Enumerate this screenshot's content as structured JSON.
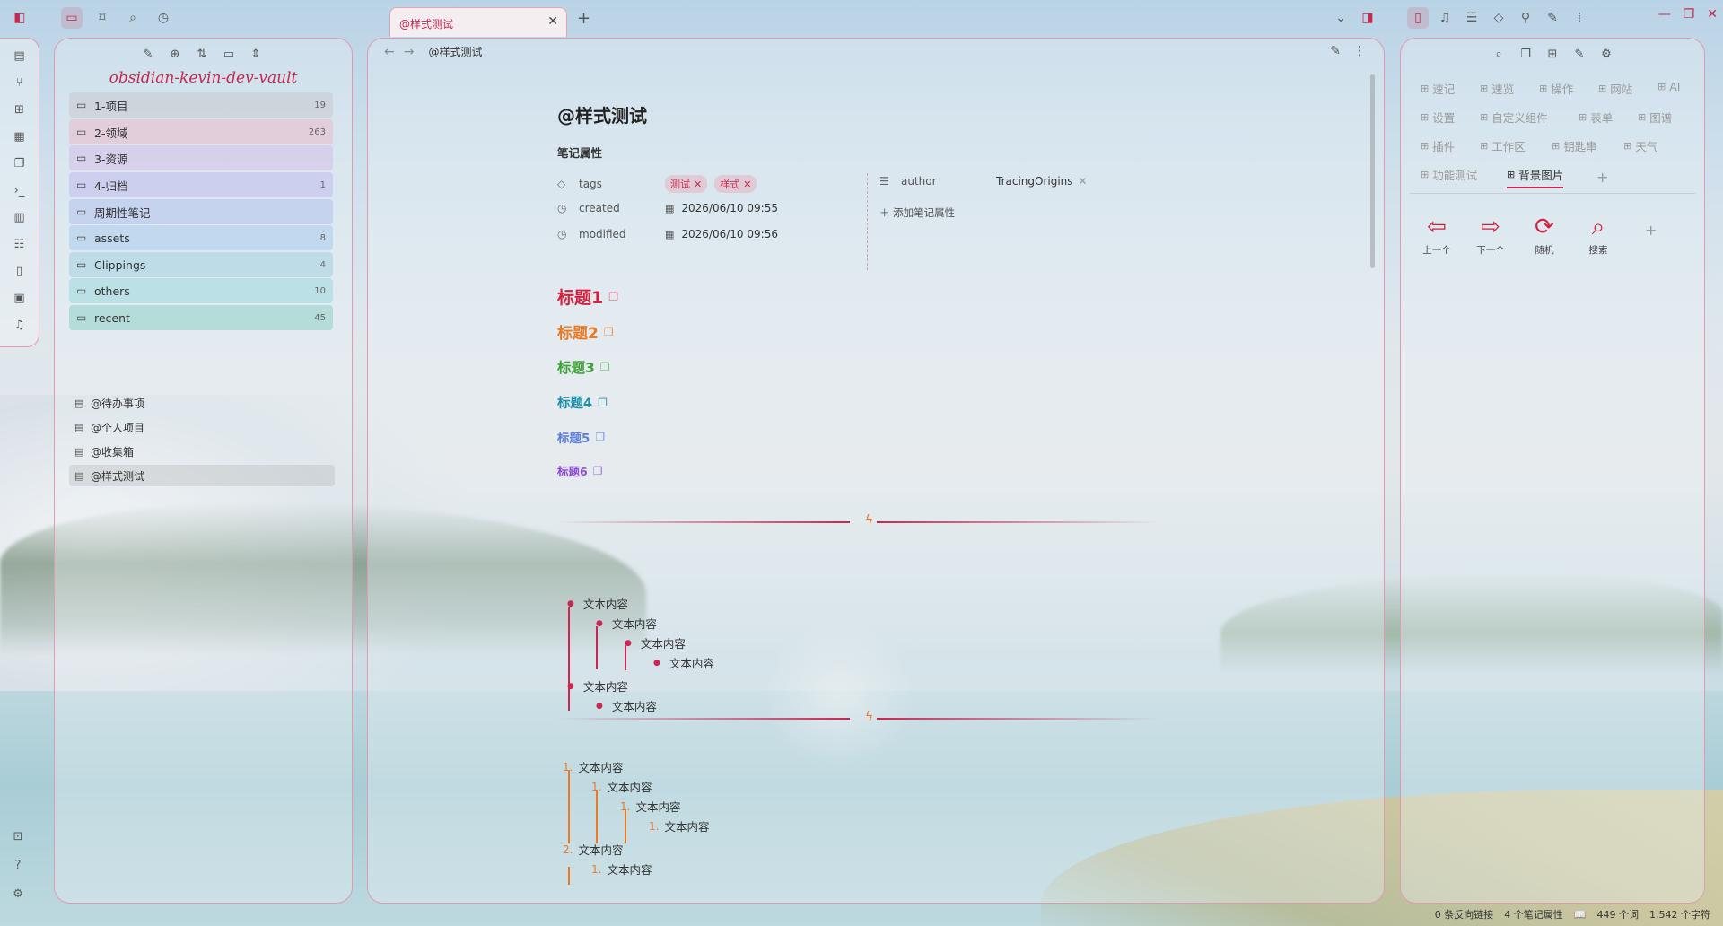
{
  "titlebar": {
    "tab_title": "@样式测试",
    "tab_close": "✕",
    "new_tab": "+",
    "window_controls": [
      "—",
      "❐",
      "✕"
    ]
  },
  "left_panel": {
    "vault_name": "obsidian-kevin-dev-vault",
    "folders": [
      {
        "name": "1-项目",
        "count": "19",
        "color": "rgba(200,200,205,0.55)"
      },
      {
        "name": "2-领域",
        "count": "263",
        "color": "rgba(233,190,205,0.6)"
      },
      {
        "name": "3-资源",
        "count": "",
        "color": "rgba(214,196,232,0.65)"
      },
      {
        "name": "4-归档",
        "count": "1",
        "color": "rgba(198,194,236,0.65)"
      },
      {
        "name": "周期性笔记",
        "count": "",
        "color": "rgba(186,200,238,0.65)"
      },
      {
        "name": "assets",
        "count": "8",
        "color": "rgba(178,208,236,0.65)"
      },
      {
        "name": "Clippings",
        "count": "4",
        "color": "rgba(172,214,228,0.65)"
      },
      {
        "name": "others",
        "count": "10",
        "color": "rgba(166,218,222,0.65)"
      },
      {
        "name": "recent",
        "count": "45",
        "color": "rgba(160,214,206,0.7)"
      }
    ],
    "notes": [
      "@待办事项",
      "@个人项目",
      "@收集箱",
      "@样式测试"
    ]
  },
  "center": {
    "breadcrumb": "@样式测试",
    "note_title": "@样式测试",
    "props_title": "笔记属性",
    "props": {
      "tags_key": "tags",
      "tags": [
        "测试",
        "样式"
      ],
      "created_key": "created",
      "created_val": "2026/06/10  09:55",
      "modified_key": "modified",
      "modified_val": "2026/06/10  09:56",
      "author_key": "author",
      "author_val": "TracingOrigins",
      "add_prop": "添加笔记属性"
    },
    "headings": [
      "标题1",
      "标题2",
      "标题3",
      "标题4",
      "标题5",
      "标题6"
    ],
    "list_text": "文本内容",
    "ordered_numbers": [
      "1.",
      "1.",
      "1.",
      "1.",
      "2.",
      "1."
    ]
  },
  "right_panel": {
    "tabs": [
      "速记",
      "速览",
      "操作",
      "网站",
      "AI",
      "设置",
      "自定义组件",
      "表单",
      "图谱",
      "插件",
      "工作区",
      "钥匙串",
      "天气",
      "功能测试",
      "背景图片"
    ],
    "active_tab": "背景图片",
    "actions": [
      {
        "label": "上一个",
        "icon": "⇦"
      },
      {
        "label": "下一个",
        "icon": "⇨"
      },
      {
        "label": "随机",
        "icon": "⟳"
      },
      {
        "label": "搜索",
        "icon": "⌕"
      }
    ]
  },
  "statusbar": {
    "backlinks": "0 条反向链接",
    "properties": "4 个笔记属性",
    "words": "449 个词",
    "chars": "1,542 个字符"
  },
  "colors": {
    "accent": "#c8274f",
    "orange": "#ec7a25"
  }
}
